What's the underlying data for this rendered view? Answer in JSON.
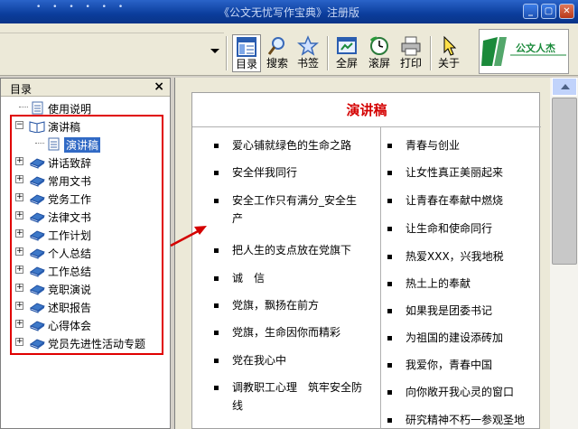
{
  "window": {
    "title": "《公文无忧写作宝典》注册版",
    "dots": "• • • • • •"
  },
  "toolbar": {
    "buttons": [
      {
        "label": "目录",
        "icon": "catalog-icon",
        "active": true
      },
      {
        "label": "搜索",
        "icon": "search-icon"
      },
      {
        "label": "书签",
        "icon": "bookmark-icon"
      },
      {
        "label": "全屏",
        "icon": "fullscreen-icon"
      },
      {
        "label": "滚屏",
        "icon": "autoscroll-clock-icon"
      },
      {
        "label": "打印",
        "icon": "printer-icon"
      },
      {
        "label": "关于",
        "icon": "pointer-cursor-icon"
      }
    ],
    "logo_text": "公文人杰"
  },
  "sidebar": {
    "header": "目录",
    "close": "×",
    "items": [
      {
        "label": "使用说明",
        "type": "page"
      },
      {
        "label": "演讲稿",
        "type": "book-open",
        "expander": "−"
      },
      {
        "label": "演讲稿",
        "type": "page-selected"
      },
      {
        "label": "讲话致辞",
        "type": "book",
        "expander": "+"
      },
      {
        "label": "常用文书",
        "type": "book",
        "expander": "+"
      },
      {
        "label": "党务工作",
        "type": "book",
        "expander": "+"
      },
      {
        "label": "法律文书",
        "type": "book",
        "expander": "+"
      },
      {
        "label": "工作计划",
        "type": "book",
        "expander": "+"
      },
      {
        "label": "个人总结",
        "type": "book",
        "expander": "+"
      },
      {
        "label": "工作总结",
        "type": "book",
        "expander": "+"
      },
      {
        "label": "竞职演说",
        "type": "book",
        "expander": "+"
      },
      {
        "label": "述职报告",
        "type": "book",
        "expander": "+"
      },
      {
        "label": "心得体会",
        "type": "book",
        "expander": "+"
      },
      {
        "label": "党员先进性活动专题",
        "type": "book",
        "expander": "+"
      }
    ]
  },
  "main": {
    "title": "演讲稿",
    "left_column": [
      "爱心铺就绿色的生命之路",
      "安全伴我同行",
      "安全工作只有满分_安全生产",
      "把人生的支点放在党旗下",
      "诚　信",
      "党旗，飘扬在前方",
      "党旗，生命因你而精彩",
      "党在我心中",
      "调教职工心理　筑牢安全防线"
    ],
    "right_column": [
      "青春与创业",
      "让女性真正美丽起来",
      "让青春在奉献中燃烧",
      "让生命和使命同行",
      "热爱XXX，兴我地税",
      "热土上的奉献",
      "如果我是团委书记",
      "为祖国的建设添砖加",
      "我爱你，青春中国",
      "向你敞开我心灵的窗口",
      "研究精神不朽一参观圣地"
    ]
  },
  "colors": {
    "title_red": "#d40000",
    "highlight_box": "#e00000",
    "selection": "#316ac5"
  }
}
